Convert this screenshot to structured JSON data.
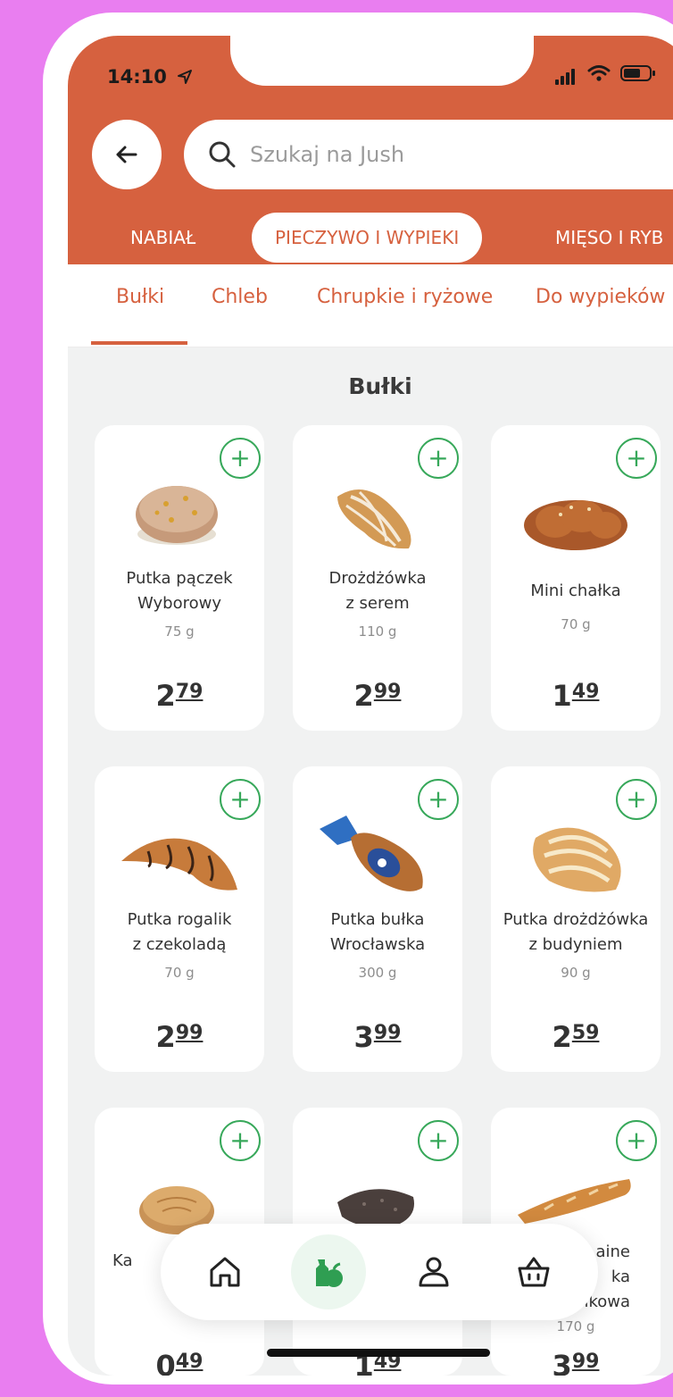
{
  "status_bar": {
    "time": "14:10"
  },
  "search": {
    "placeholder": "Szukaj na Jush"
  },
  "categories": [
    "NABIAŁ",
    "PIECZYWO I WYPIEKI",
    "MIĘSO I RYB"
  ],
  "subcategories": [
    "Bułki",
    "Chleb",
    "Chrupkie i ryżowe",
    "Do wypieków"
  ],
  "section_title": "Bułki",
  "products": [
    {
      "name1": "Putka pączek",
      "name2": "Wyborowy",
      "weight": "75 g",
      "price_int": "2",
      "price_dec": "79"
    },
    {
      "name1": "Drożdżówka",
      "name2": "z serem",
      "weight": "110 g",
      "price_int": "2",
      "price_dec": "99"
    },
    {
      "name1": "Mini chałka",
      "name2": "",
      "weight": "70 g",
      "price_int": "1",
      "price_dec": "49"
    },
    {
      "name1": "Putka rogalik",
      "name2": "z czekoladą",
      "weight": "70 g",
      "price_int": "2",
      "price_dec": "99"
    },
    {
      "name1": "Putka bułka",
      "name2": "Wrocławska",
      "weight": "300 g",
      "price_int": "3",
      "price_dec": "99"
    },
    {
      "name1": "Putka drożdżówka",
      "name2": "z budyniem",
      "weight": "90 g",
      "price_int": "2",
      "price_dec": "59"
    },
    {
      "name1": "Ka",
      "name2": "",
      "weight": "",
      "price_int": "0",
      "price_dec": "49"
    },
    {
      "name1": "",
      "name2": "",
      "weight": "",
      "price_int": "1",
      "price_dec": "49"
    },
    {
      "name1": "aine",
      "name2": "ka",
      "name3": "ikowa",
      "weight": "170 g",
      "price_int": "3",
      "price_dec": "99"
    }
  ],
  "add_symbol": "+",
  "colors": {
    "brand": "#d6613f",
    "accent_green": "#37a85a",
    "background": "#e97ef0"
  },
  "nav_icons": [
    "home-icon",
    "groceries-icon",
    "profile-icon",
    "basket-icon"
  ]
}
